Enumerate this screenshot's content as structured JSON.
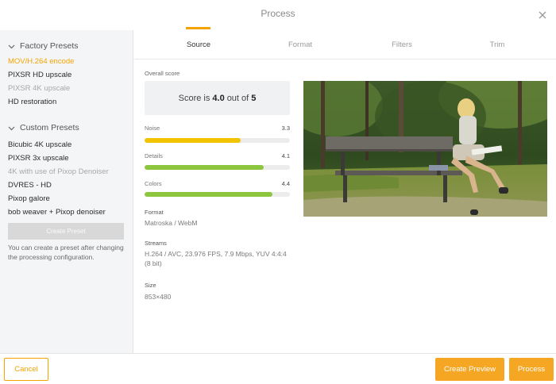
{
  "window": {
    "title": "Process"
  },
  "sidebar": {
    "factory_title": "Factory Presets",
    "factory_presets": [
      {
        "label": "MOV/H.264 encode",
        "state": "active"
      },
      {
        "label": "PIXSR HD upscale",
        "state": "normal"
      },
      {
        "label": "PIXSR 4K upscale",
        "state": "disabled"
      },
      {
        "label": "HD restoration",
        "state": "normal"
      }
    ],
    "custom_title": "Custom Presets",
    "custom_presets": [
      {
        "label": "Bicubic 4K upscale",
        "state": "normal"
      },
      {
        "label": "PIXSR 3x upscale",
        "state": "normal"
      },
      {
        "label": "4K with use of Pixop Denoiser",
        "state": "disabled"
      },
      {
        "label": "DVRES - HD",
        "state": "normal"
      },
      {
        "label": "Pixop galore",
        "state": "normal"
      },
      {
        "label": "bob weaver + Pixop denoiser",
        "state": "normal"
      }
    ],
    "create_preset_label": "Create Preset",
    "hint": "You can create a preset after changing the processing configuration."
  },
  "tabs": [
    {
      "label": "Source",
      "active": true
    },
    {
      "label": "Format",
      "active": false
    },
    {
      "label": "Filters",
      "active": false
    },
    {
      "label": "Trim",
      "active": false
    }
  ],
  "source": {
    "overall_label": "Overall score",
    "score_prefix": "Score is",
    "score_value": "4.0",
    "score_mid": "out of",
    "score_max": "5",
    "metrics": [
      {
        "name": "Noise",
        "value": "3.3",
        "fraction": 0.66,
        "color": "#f2c300"
      },
      {
        "name": "Details",
        "value": "4.1",
        "fraction": 0.82,
        "color": "#8cc63f"
      },
      {
        "name": "Colors",
        "value": "4.4",
        "fraction": 0.88,
        "color": "#8cc63f"
      }
    ],
    "format_label": "Format",
    "format_value": "Matroska / WebM",
    "streams_label": "Streams",
    "streams_value": "H.264 / AVC, 23.976 FPS, 7.9 Mbps, YUV 4:4:4 (8 bit)",
    "size_label": "Size",
    "size_value": "853×480"
  },
  "footer": {
    "cancel_label": "Cancel",
    "create_preview_label": "Create Preview",
    "process_label": "Process"
  },
  "colors": {
    "accent": "#f5a300",
    "button": "#f5a623"
  }
}
